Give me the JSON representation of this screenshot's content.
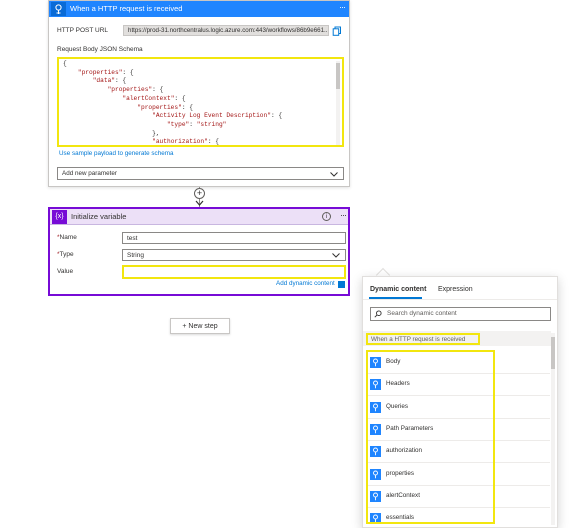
{
  "trigger": {
    "title": "When a HTTP request is received",
    "url_label": "HTTP POST URL",
    "url_value": "https://prod-31.northcentralus.logic.azure.com:443/workflows/86b9e661...",
    "schema_label": "Request Body JSON Schema",
    "schema_lines": [
      "{",
      "    \"properties\": {",
      "        \"data\": {",
      "            \"properties\": {",
      "                \"alertContext\": {",
      "                    \"properties\": {",
      "                        \"Activity Log Event Description\": {",
      "                            \"type\": \"string\"",
      "                        },",
      "                        \"authorization\": {"
    ],
    "sample_link": "Use sample payload to generate schema",
    "add_param_placeholder": "Add new parameter"
  },
  "variable": {
    "title": "Initialize variable",
    "name_label": "Name",
    "name_value": "test",
    "type_label": "Type",
    "type_value": "String",
    "value_label": "Value",
    "value_value": "",
    "add_dynamic_label": "Add dynamic content"
  },
  "new_step_label": "+ New step",
  "dynamic_panel": {
    "tabs": [
      "Dynamic content",
      "Expression"
    ],
    "active_tab": "Dynamic content",
    "search_placeholder": "Search dynamic content",
    "section_header": "When a HTTP request is received",
    "items": [
      "Body",
      "Headers",
      "Queries",
      "Path Parameters",
      "authorization",
      "properties",
      "alertContext",
      "essentials"
    ]
  },
  "colors": {
    "trigger_header": "#1f85ff",
    "variable_accent": "#770bd6",
    "highlight": "#f2e60f",
    "link": "#0078d4"
  },
  "icons": {
    "trigger": "http-request-icon",
    "variable": "variable-icon",
    "copy": "copy-icon",
    "info": "info-icon",
    "search": "search-icon",
    "dropdown": "chevron-down-icon"
  }
}
